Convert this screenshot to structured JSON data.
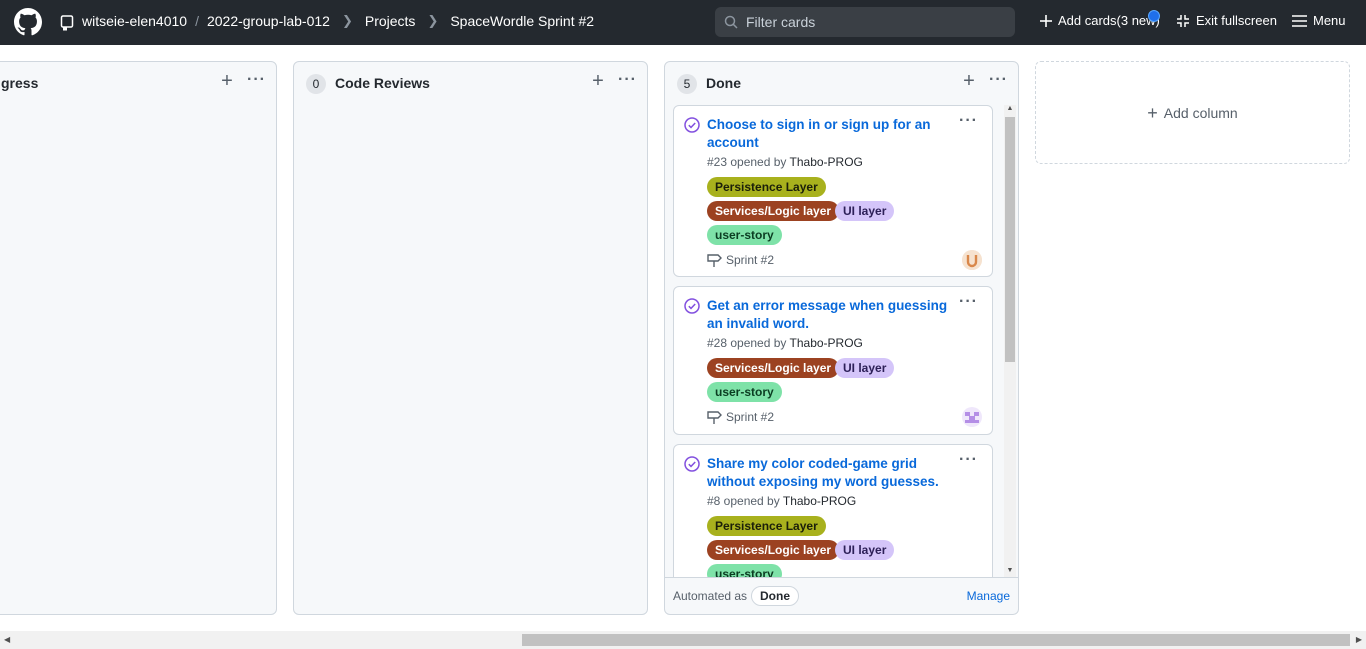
{
  "header": {
    "owner": "witseie-elen4010",
    "separator": "/",
    "repo": "2022-group-lab-012",
    "projects": "Projects",
    "board": "SpaceWordle Sprint #2",
    "filter_placeholder": "Filter cards",
    "add_cards": "Add cards(3 new)",
    "exit_fullscreen": "Exit fullscreen",
    "menu": "Menu"
  },
  "columns": [
    {
      "title": "In progress",
      "visible_title": "gress"
    },
    {
      "count": "0",
      "title": "Code Reviews"
    },
    {
      "count": "5",
      "title": "Done",
      "automated_label": "Automated as",
      "automated_value": "Done",
      "manage": "Manage",
      "cards": [
        {
          "title": "Choose to sign in or sign up for an account",
          "number": "#23 opened by",
          "author": "Thabo-PROG",
          "labels": [
            "Persistence Layer",
            "Services/Logic layer",
            "UI layer",
            "user-story"
          ],
          "milestone": "Sprint #2"
        },
        {
          "title": "Get an error message when guessing an invalid word.",
          "number": "#28 opened by",
          "author": "Thabo-PROG",
          "labels": [
            "Services/Logic layer",
            "UI layer",
            "user-story"
          ],
          "milestone": "Sprint #2"
        },
        {
          "title": "Share my color coded-game grid without exposing my word guesses.",
          "number": "#8 opened by",
          "author": "Thabo-PROG",
          "labels": [
            "Persistence Layer",
            "Services/Logic layer",
            "UI layer",
            "user-story"
          ],
          "milestone": "Sprint #2"
        }
      ]
    }
  ],
  "add_column": "Add column",
  "colors": {
    "header_bg": "#24292f",
    "link": "#0969da",
    "check": "#8250df",
    "label_persistence": "#a8b11d",
    "label_services": "#9c4221",
    "label_ui": "#d4c5f9",
    "label_story": "#7ee2a8"
  }
}
